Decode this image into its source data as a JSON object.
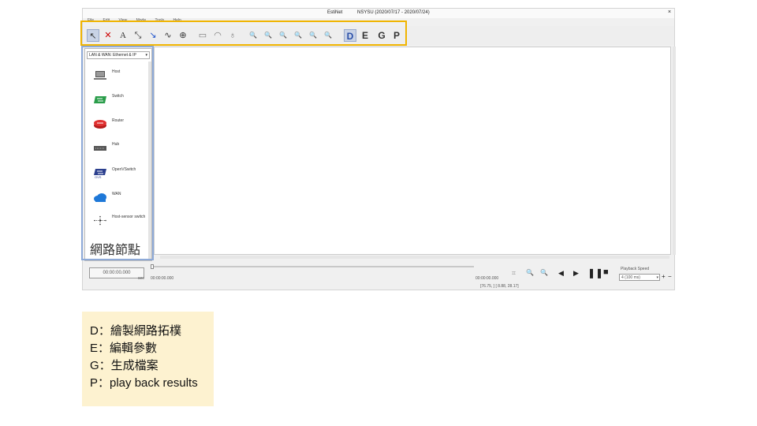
{
  "window": {
    "app_name": "EstiNet",
    "title_info": "NSYSU (2020/07/17 - 2020/07/24)",
    "close_label": "×",
    "menu": [
      "File",
      "Edit",
      "View",
      "Mode",
      "Tools",
      "Help"
    ]
  },
  "toolbar": {
    "tools": [
      {
        "name": "select-tool-icon",
        "glyph": "↖"
      },
      {
        "name": "delete-tool-icon",
        "glyph": "✕"
      },
      {
        "name": "text-tool-icon",
        "glyph": "A"
      },
      {
        "name": "link-tool-icon",
        "glyph": "⤡"
      },
      {
        "name": "wire-tool-icon",
        "glyph": "↘"
      },
      {
        "name": "path-tool-icon",
        "glyph": "∿"
      },
      {
        "name": "range-tool-icon",
        "glyph": "⊕"
      },
      {
        "name": "ruler-tool-icon",
        "glyph": "▭"
      },
      {
        "name": "protractor-tool-icon",
        "glyph": "◠"
      },
      {
        "name": "bulb-tool-icon",
        "glyph": "♁"
      },
      {
        "name": "zoom-in-icon",
        "glyph": "🔍"
      },
      {
        "name": "zoom-out-icon",
        "glyph": "🔍"
      },
      {
        "name": "zoom-fit-icon",
        "glyph": "🔍"
      },
      {
        "name": "zoom-area-icon",
        "glyph": "🔍"
      },
      {
        "name": "zoom-node-icon",
        "glyph": "🔍"
      },
      {
        "name": "zoom-reset-icon",
        "glyph": "🔍"
      }
    ],
    "modes": [
      "D",
      "E",
      "G",
      "P"
    ]
  },
  "panel": {
    "dropdown_value": "LAN & WAN: Ethernet & IP",
    "nodes": [
      "Host",
      "Switch",
      "Router",
      "Hub",
      "OpenVSwitch",
      "WAN",
      "Host-sensor switch"
    ],
    "caption": "網路節點"
  },
  "bottom": {
    "start_time": "00:00:00.000",
    "sec_label": "sec",
    "time_readout": "00:00:00.000",
    "coord_readout": "00:00:00.000",
    "position_readout": "[76.75,    ] [ 8.88, 28.17]",
    "playback_label": "Playback Speed",
    "playback_value": "4 (100 ms)"
  },
  "legend": {
    "lines": [
      "D：繪製網路拓樸",
      "E：編輯參數",
      "G：生成檔案",
      "P：play back results"
    ]
  },
  "colors": {
    "toolbar_highlight": "#f0b400",
    "panel_highlight": "#8eaad8",
    "legend_bg": "#fdf2d0"
  }
}
